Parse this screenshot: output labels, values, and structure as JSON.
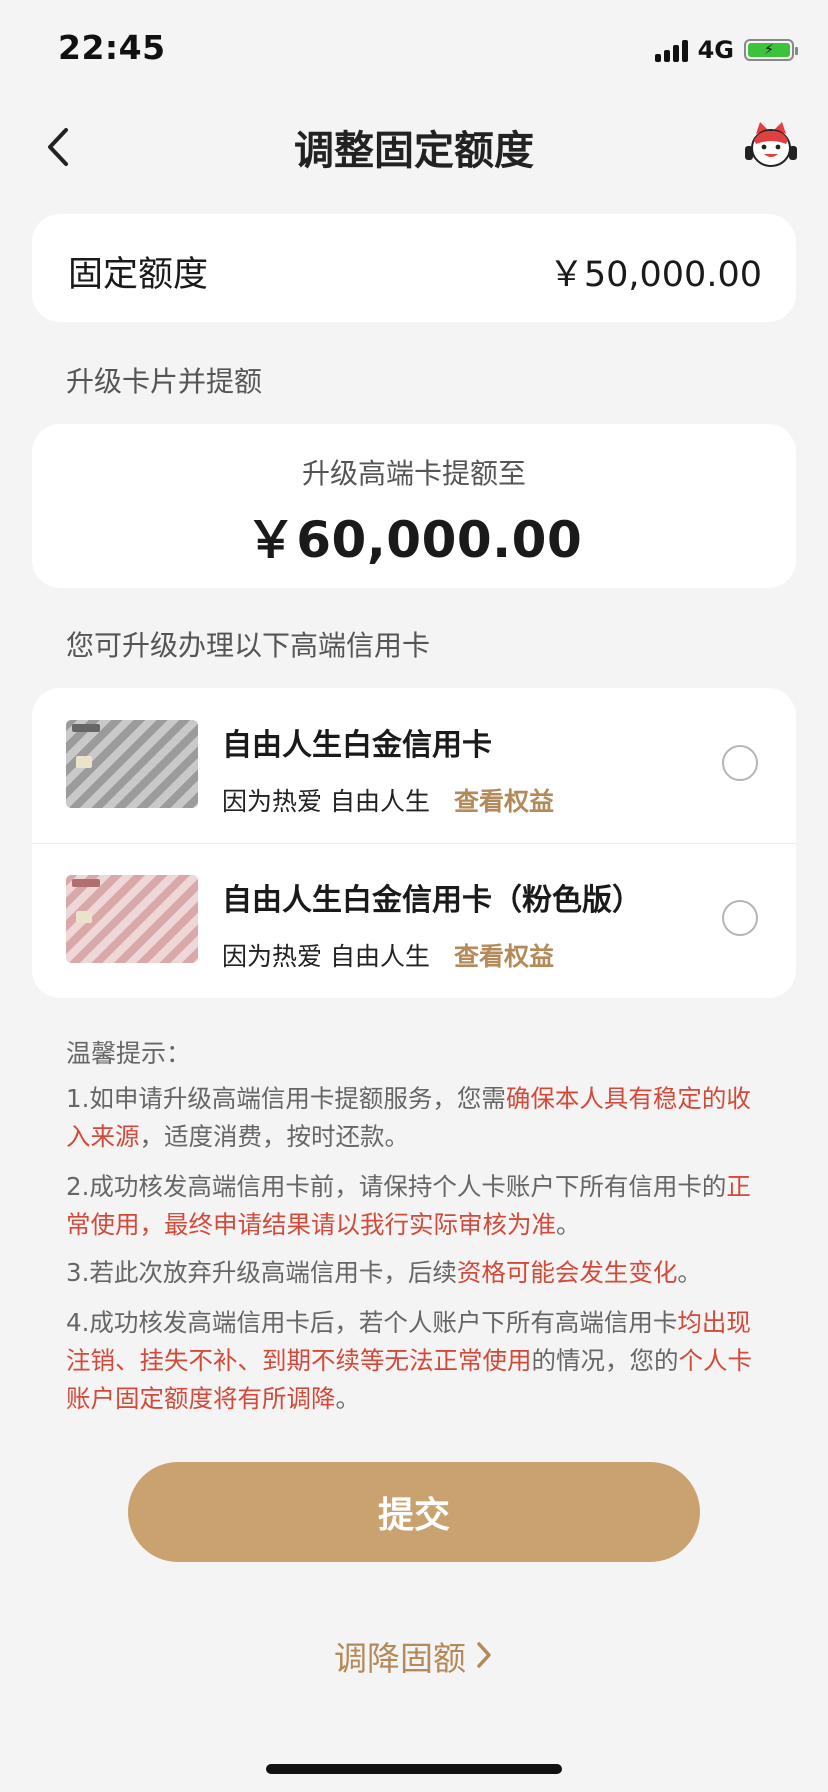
{
  "status_bar": {
    "time": "22:45",
    "network": "4G"
  },
  "nav": {
    "title": "调整固定额度"
  },
  "fixed_limit": {
    "label": "固定额度",
    "value": "￥50,000.00"
  },
  "upgrade_section": {
    "heading": "升级卡片并提额",
    "label": "升级高端卡提额至",
    "value": "￥60,000.00"
  },
  "cards_section": {
    "heading": "您可升级办理以下高端信用卡",
    "cards": [
      {
        "name": "自由人生白金信用卡",
        "slogan": "因为热爱 自由人生",
        "link": "查看权益",
        "selected": false
      },
      {
        "name": "自由人生白金信用卡（粉色版）",
        "slogan": "因为热爱 自由人生",
        "link": "查看权益",
        "selected": false
      }
    ]
  },
  "tips": {
    "title": "温馨提示：",
    "t1_a": "1.如申请升级高端信用卡提额服务，您需",
    "t1_b": "确保本人具有稳定的收入来源",
    "t1_c": "，适度消费，按时还款。",
    "t2_a": "2.成功核发高端信用卡前，请保持个人卡账户下所有信用卡的",
    "t2_b": "正常使用，最终申请结果请以我行实际审核为准",
    "t2_c": "。",
    "t3_a": "3.若此次放弃升级高端信用卡，后续",
    "t3_b": "资格可能会发生变化",
    "t3_c": "。",
    "t4_a": "4.成功核发高端信用卡后，若个人账户下所有高端信用卡",
    "t4_b": "均出现注销、挂失不补、到期不续等无法正常使用",
    "t4_c": "的情况，您的",
    "t4_d": "个人卡账户固定额度将有所调降",
    "t4_e": "。"
  },
  "actions": {
    "submit": "提交",
    "reduce": "调降固额"
  },
  "colors": {
    "accent": "#c9a270",
    "link": "#b48a5a",
    "warning": "#d44a3a"
  },
  "icons": {
    "back": "chevron-left-icon",
    "mascot": "mascot-icon",
    "reduce_chevron": "chevron-right-icon"
  }
}
